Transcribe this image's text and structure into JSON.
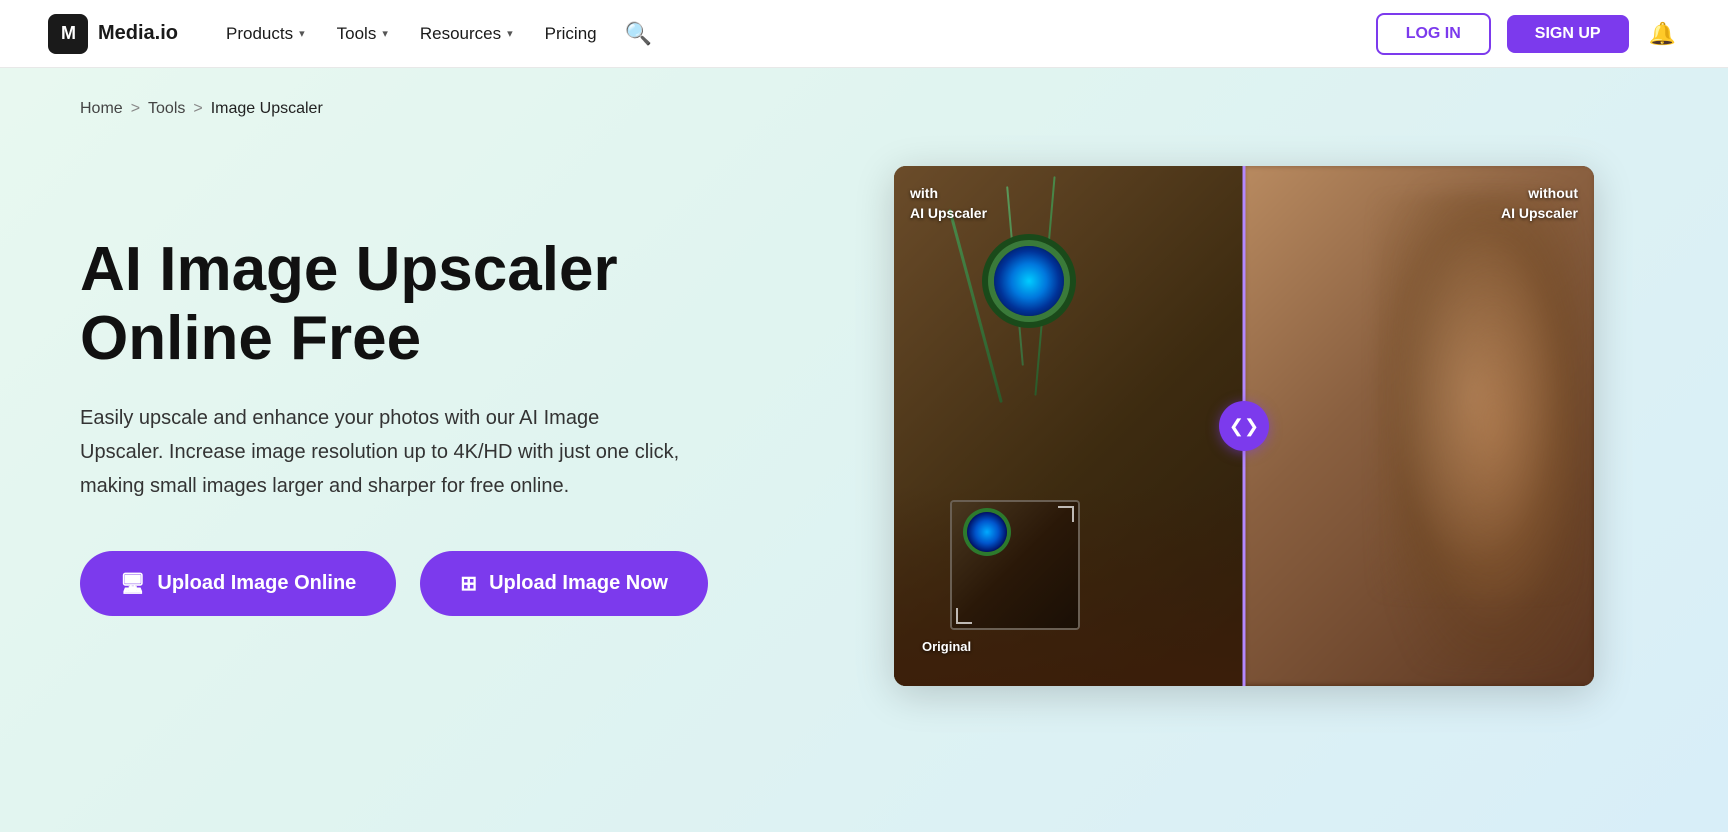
{
  "brand": {
    "logo_text": "M",
    "name": "Media.io"
  },
  "nav": {
    "items": [
      {
        "label": "Products",
        "has_dropdown": true
      },
      {
        "label": "Tools",
        "has_dropdown": true
      },
      {
        "label": "Resources",
        "has_dropdown": true
      },
      {
        "label": "Pricing",
        "has_dropdown": false
      }
    ],
    "login_label": "LOG IN",
    "signup_label": "SIGN UP"
  },
  "breadcrumb": {
    "home": "Home",
    "sep1": ">",
    "tools": "Tools",
    "sep2": ">",
    "current": "Image Upscaler"
  },
  "hero": {
    "title_line1": "AI Image Upscaler",
    "title_line2": "Online Free",
    "description": "Easily upscale and enhance your photos with our AI Image Upscaler. Increase image resolution up to 4K/HD with just one click, making small images larger and sharper for free online.",
    "btn_upload_online": "Upload Image Online",
    "btn_upload_now": "Upload Image Now"
  },
  "comparison": {
    "label_with": "with\nAI Upscaler",
    "label_without": "without\nAI Upscaler",
    "original_label": "Original"
  }
}
